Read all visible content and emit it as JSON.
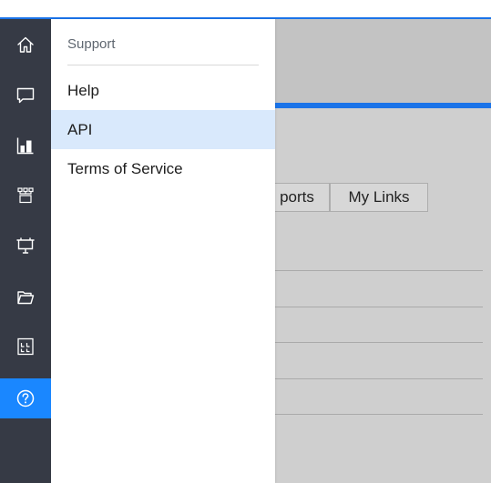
{
  "sidebar": {
    "items": [
      {
        "icon": "home-icon"
      },
      {
        "icon": "chat-icon"
      },
      {
        "icon": "bar-chart-icon"
      },
      {
        "icon": "org-chart-icon"
      },
      {
        "icon": "presentation-icon"
      },
      {
        "icon": "folder-icon"
      },
      {
        "icon": "grid-icon"
      },
      {
        "icon": "help-icon",
        "active": true
      }
    ],
    "accent_color": "#1a87ff",
    "background_color": "#363a45"
  },
  "dropdown": {
    "header": "Support",
    "items": [
      {
        "label": "Help"
      },
      {
        "label": "API",
        "selected": true
      },
      {
        "label": "Terms of Service"
      }
    ]
  },
  "background_tabs": {
    "reports_partial": "ports",
    "my_links": "My Links"
  }
}
